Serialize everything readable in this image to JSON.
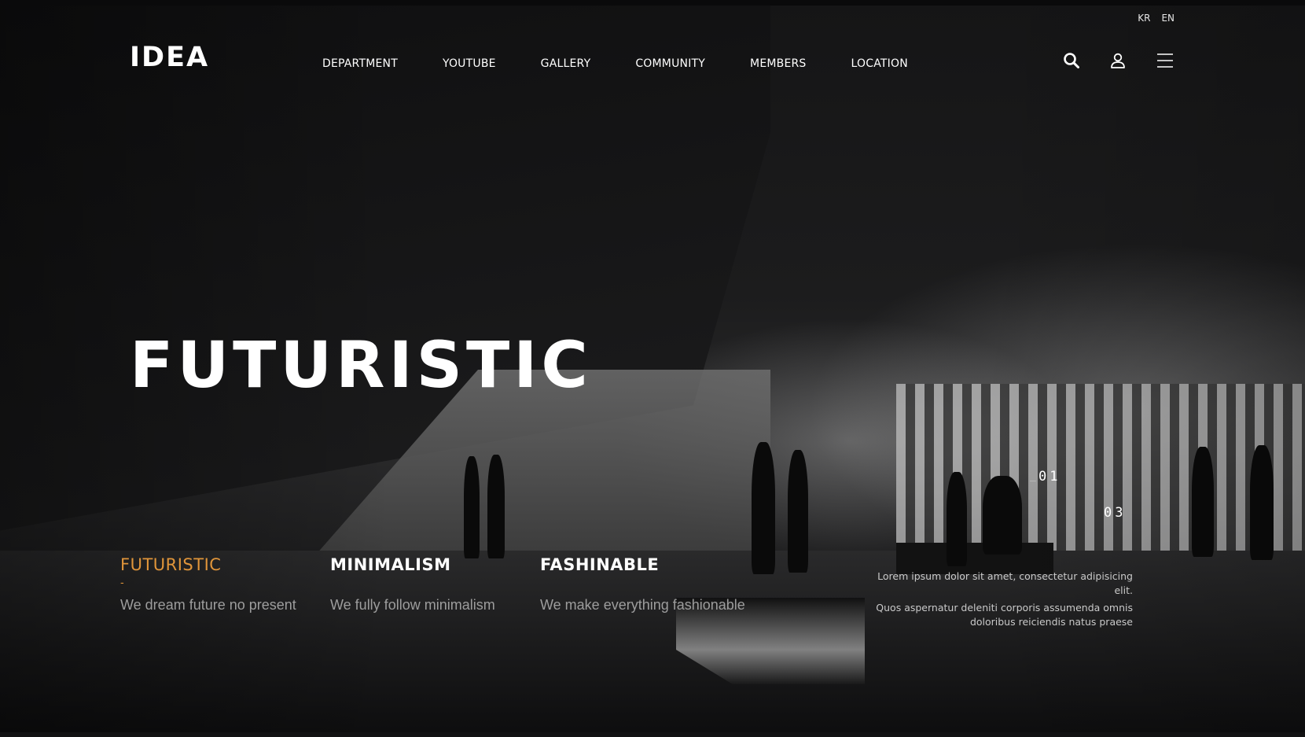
{
  "header": {
    "logo": "IDEA",
    "languages": [
      "KR",
      "EN"
    ],
    "nav": [
      "DEPARTMENT",
      "YOUTUBE",
      "GALLERY",
      "COMMUNITY",
      "MEMBERS",
      "LOCATION"
    ],
    "icons": [
      "search-icon",
      "user-icon",
      "hamburger-menu-icon"
    ]
  },
  "hero": {
    "title": "FUTURISTIC"
  },
  "features": [
    {
      "title": "FUTURISTIC",
      "marker": "-",
      "description": "We dream future no present",
      "active": true
    },
    {
      "title": "MINIMALISM",
      "description": "We fully follow minimalism",
      "active": false
    },
    {
      "title": "FASHINABLE",
      "description": "We make everything fashionable",
      "active": false
    }
  ],
  "pager": {
    "prefix": "_",
    "current": "01",
    "total": "03"
  },
  "side_text": {
    "paragraph1": "Lorem ipsum dolor sit amet, consectetur adipisicing elit.",
    "paragraph2": "Quos aspernatur deleniti corporis assumenda omnis doloribus reiciendis natus praese"
  },
  "colors": {
    "accent": "#e0953a",
    "text": "#ffffff",
    "muted": "#9d9d9d"
  }
}
